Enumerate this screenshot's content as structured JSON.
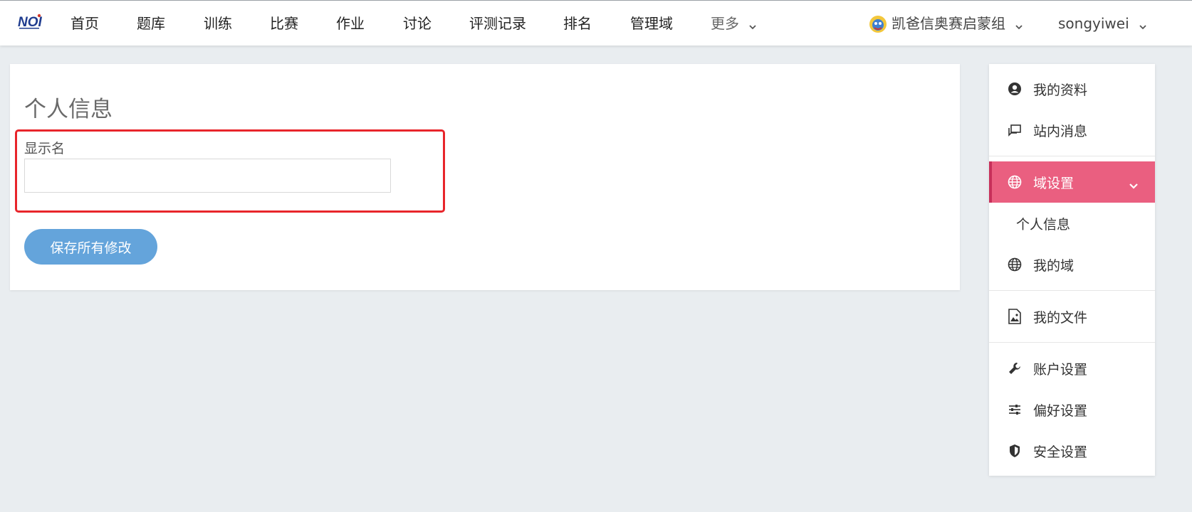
{
  "nav": {
    "items": [
      {
        "label": "首页"
      },
      {
        "label": "题库"
      },
      {
        "label": "训练"
      },
      {
        "label": "比赛"
      },
      {
        "label": "作业"
      },
      {
        "label": "讨论"
      },
      {
        "label": "评测记录"
      },
      {
        "label": "排名"
      },
      {
        "label": "管理域"
      }
    ],
    "more_label": "更多",
    "group_label": "凯爸信奥赛启蒙组",
    "user_label": "songyiwei"
  },
  "main": {
    "title": "个人信息",
    "display_name_label": "显示名",
    "display_name_value": "",
    "save_label": "保存所有修改"
  },
  "sidebar": {
    "items": [
      {
        "label": "我的资料",
        "icon": "user-circle-icon"
      },
      {
        "label": "站内消息",
        "icon": "message-icon"
      },
      {
        "label": "域设置",
        "icon": "globe-icon"
      },
      {
        "label": "个人信息",
        "icon": ""
      },
      {
        "label": "我的域",
        "icon": "globe-icon"
      },
      {
        "label": "我的文件",
        "icon": "image-file-icon"
      },
      {
        "label": "账户设置",
        "icon": "wrench-icon"
      },
      {
        "label": "偏好设置",
        "icon": "sliders-icon"
      },
      {
        "label": "安全设置",
        "icon": "shield-icon"
      }
    ]
  },
  "colors": {
    "accent_pink": "#ea5f80",
    "button_blue": "#64a4db",
    "highlight_red": "#e8252b",
    "page_bg": "#e9edf0"
  }
}
